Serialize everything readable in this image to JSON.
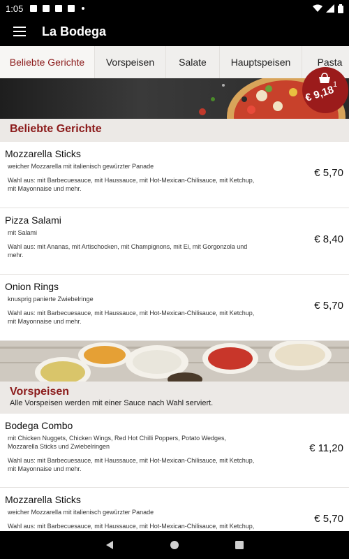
{
  "status_bar": {
    "time": "1:05"
  },
  "app_bar": {
    "title": "La Bodega",
    "menu_icon": "hamburger-menu-icon"
  },
  "tabs": [
    {
      "label": "Beliebte Gerichte",
      "active": true
    },
    {
      "label": "Vorspeisen",
      "active": false
    },
    {
      "label": "Salate",
      "active": false
    },
    {
      "label": "Hauptspeisen",
      "active": false
    },
    {
      "label": "Pasta",
      "active": false
    }
  ],
  "cart": {
    "count": "1",
    "total": "€ 9,18",
    "icon": "shopping-bag-icon"
  },
  "sections": [
    {
      "title": "Beliebte Gerichte",
      "items": [
        {
          "name": "Mozzarella Sticks",
          "description": "weicher Mozzarella mit italienisch gewürzter Panade",
          "options": "Wahl aus: mit Barbecuesauce, mit Haussauce, mit Hot-Mexican-Chilisauce, mit Ketchup, mit Mayonnaise und mehr.",
          "price": "€ 5,70"
        },
        {
          "name": "Pizza Salami",
          "description": "mit Salami",
          "options": "Wahl aus: mit Ananas, mit Artischocken, mit Champignons, mit Ei, mit Gorgonzola und mehr.",
          "price": "€ 8,40"
        },
        {
          "name": "Onion Rings",
          "description": "knusprig panierte Zwiebelringe",
          "options": "Wahl aus: mit Barbecuesauce, mit Haussauce, mit Hot-Mexican-Chilisauce, mit Ketchup, mit Mayonnaise und mehr.",
          "price": "€ 5,70"
        }
      ]
    },
    {
      "title": "Vorspeisen",
      "note": "Alle Vorspeisen werden mit einer Sauce nach Wahl serviert.",
      "items": [
        {
          "name": "Bodega Combo",
          "description": "mit Chicken Nuggets, Chicken Wings, Red Hot Chilli Poppers, Potato Wedges, Mozzarella Sticks und Zwiebelringen",
          "options": "Wahl aus: mit Barbecuesauce, mit Haussauce, mit Hot-Mexican-Chilisauce, mit Ketchup, mit Mayonnaise und mehr.",
          "price": "€ 11,20"
        },
        {
          "name": "Mozzarella Sticks",
          "description": "weicher Mozzarella mit italienisch gewürzter Panade",
          "options": "Wahl aus: mit Barbecuesauce, mit Haussauce, mit Hot-Mexican-Chilisauce, mit Ketchup, mit Mayonnaise und mehr.",
          "price": "€ 5,70"
        }
      ]
    }
  ],
  "colors": {
    "accent": "#8b1a1a",
    "badge": "#9b1b1b"
  }
}
